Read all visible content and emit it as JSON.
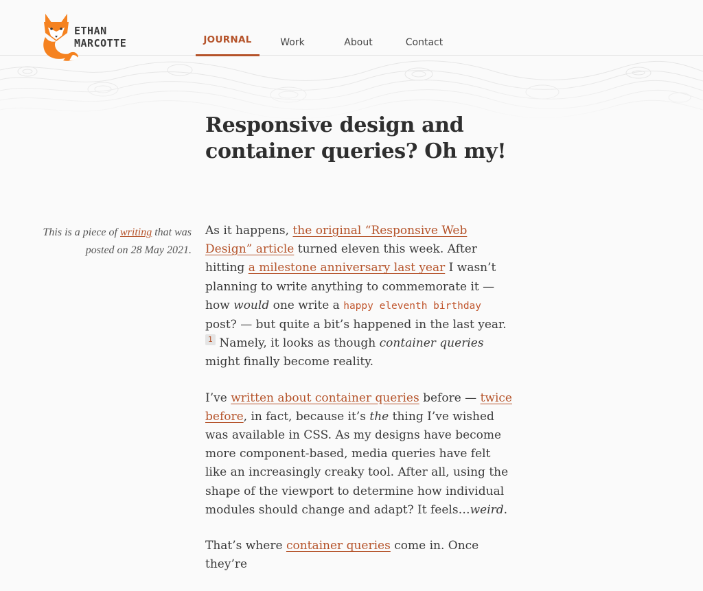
{
  "header": {
    "logo": {
      "line1": "ETHAN",
      "line2": "MARCOTTE"
    },
    "nav": [
      {
        "label": "JOURNAL",
        "active": true
      },
      {
        "label": "Work",
        "active": false
      },
      {
        "label": "About",
        "active": false
      },
      {
        "label": "Contact",
        "active": false
      }
    ]
  },
  "colors": {
    "accent": "#b5532a",
    "fox_orange": "#f58220",
    "text": "#3a3a3a",
    "background": "#fafafa"
  },
  "post": {
    "title": "Responsive design and container queries? Oh my!",
    "meta": {
      "prefix": "This is a piece of ",
      "category_link": "writing",
      "middle": " that was posted on ",
      "date": "28 May 2021",
      "suffix": "."
    },
    "paragraphs": {
      "p1": {
        "t1": "As it happens, ",
        "link1": "the original “Responsive Web Design” article",
        "t2": " turned eleven this week. After hitting ",
        "link2": "a milestone anniversary last year",
        "t3": " I wasn’t planning to write anything to commemorate it — how ",
        "em1": "would",
        "t4": " one write a ",
        "code1": "happy eleventh birthday",
        "t5": " post? — but quite a bit’s happened in the last year.",
        "footnote": "1",
        "t6": " Namely, it looks as though ",
        "em2": "container queries",
        "t7": " might finally become reality."
      },
      "p2": {
        "t1": "I’ve ",
        "link1": "written about container queries",
        "t2": " before — ",
        "link2": "twice before",
        "t3": ", in fact, because it’s ",
        "em1": "the",
        "t4": " thing I’ve wished was available in CSS. As my designs have become more component-based, media queries have felt like an increasingly creaky tool. After all, using the shape of the viewport to determine how individual modules should change and adapt? It feels…",
        "em2": "weird",
        "t5": "."
      },
      "p3": {
        "t1": "That’s where ",
        "link1": "container queries",
        "t2": " come in. Once they’re"
      }
    }
  }
}
